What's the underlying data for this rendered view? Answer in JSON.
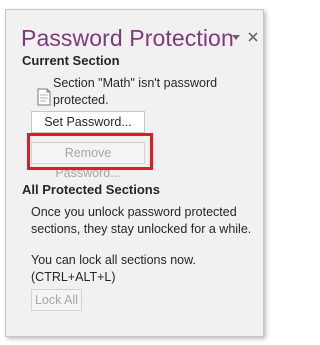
{
  "pane": {
    "title": "Password Protection",
    "current_section": {
      "heading": "Current Section",
      "status_line1": "Section \"Math\" isn't password",
      "status_line2": "protected.",
      "set_password_label": "Set Password...",
      "remove_password_label": "Remove Password..."
    },
    "all_sections": {
      "heading": "All Protected Sections",
      "info_line1": "Once you unlock password protected",
      "info_line2": "sections, they stay unlocked for a while.",
      "lock_line1": "You can lock all sections now.",
      "lock_line2": "(CTRL+ALT+L)",
      "lock_all_label": "Lock All"
    },
    "icons": {
      "menu": "dropdown-arrow-icon",
      "close": "close-icon",
      "section": "section-page-icon"
    },
    "colors": {
      "title": "#80397b",
      "highlight": "#e01b24"
    }
  }
}
